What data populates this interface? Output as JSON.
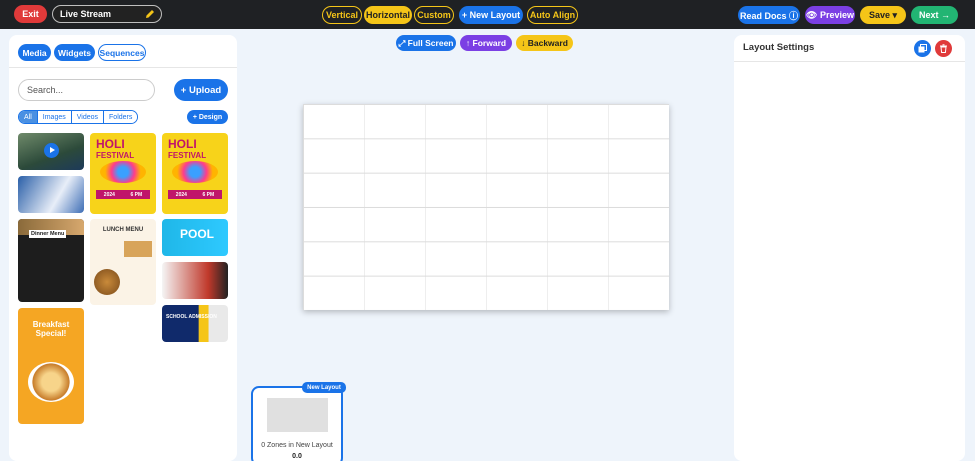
{
  "topbar": {
    "exit_label": "Exit",
    "layout_name": "Live Stream",
    "orientations": [
      "Vertical",
      "Horizontal",
      "Custom"
    ],
    "active_orientation": "Horizontal",
    "new_layout_label": "+ New Layout",
    "auto_align_label": "Auto Align",
    "read_docs_label": "Read Docs ⓘ",
    "preview_label": "👁 Preview",
    "save_label": "Save ▾",
    "next_label": "Next →"
  },
  "left_panel": {
    "tabs": [
      "Media",
      "Widgets",
      "Sequences"
    ],
    "search_placeholder": "Search...",
    "upload_label": "+ Upload",
    "filters": [
      "All",
      "Images",
      "Videos",
      "Folders"
    ],
    "design_label": "+ Design",
    "thumbs": {
      "dinner_label": "Dinner Menu",
      "breakfast_label": "Breakfast Special!",
      "holi_title": "HOLI",
      "holi_sub": "FESTIVAL",
      "holi_date": "2024",
      "holi_time": "6 PM",
      "lunch_label": "LUNCH MENU",
      "pool_label": "POOL",
      "school_label": "SCHOOL ADMISSION"
    }
  },
  "canvas_toolbar": {
    "fullscreen_label": "⤢ Full Screen",
    "forward_label": "↑ Forward",
    "backward_label": "↓ Backward"
  },
  "layout_card": {
    "badge": "New Layout",
    "zones_text": "0 Zones in New Layout",
    "duration": "0.0"
  },
  "right_panel": {
    "title": "Layout Settings"
  },
  "colors": {
    "primary": "#1a73e8",
    "purple": "#7b3fe4",
    "yellow": "#f5c518",
    "green": "#22b573",
    "red": "#e03a3a"
  }
}
